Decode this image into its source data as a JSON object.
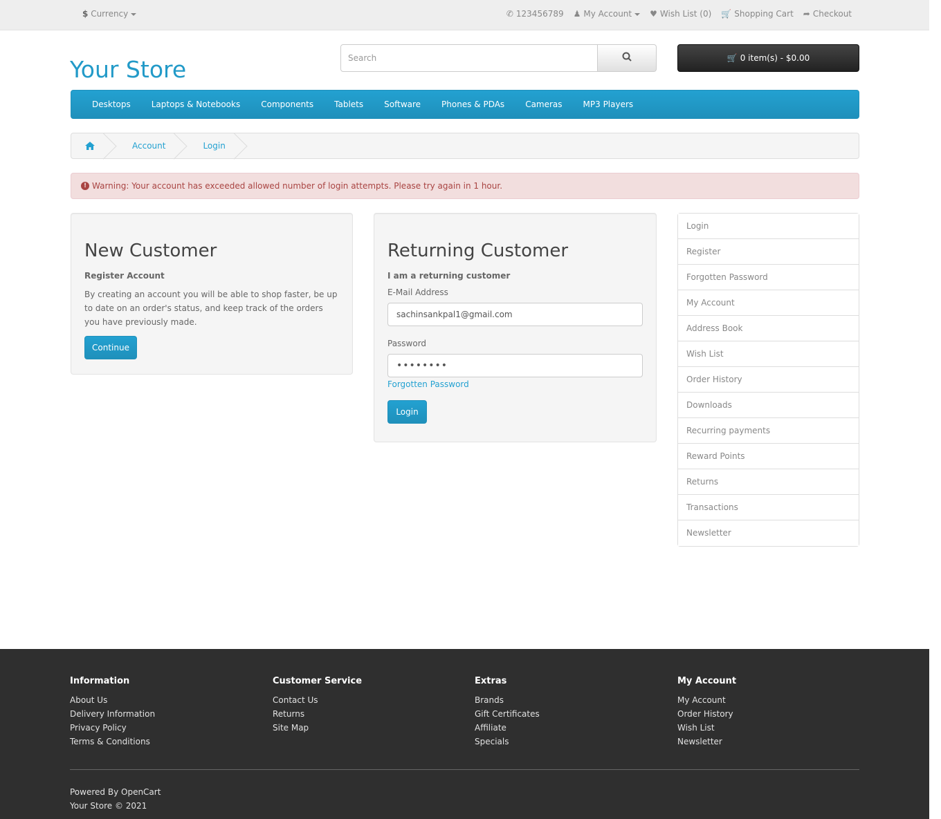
{
  "topbar": {
    "currency_symbol": "$",
    "currency_label": "Currency",
    "phone": "123456789",
    "my_account": "My Account",
    "wish_list": "Wish List (0)",
    "shopping_cart": "Shopping Cart",
    "checkout": "Checkout"
  },
  "header": {
    "logo": "Your Store",
    "search_placeholder": "Search",
    "cart_label": "0 item(s) - $0.00"
  },
  "menu": [
    "Desktops",
    "Laptops & Notebooks",
    "Components",
    "Tablets",
    "Software",
    "Phones & PDAs",
    "Cameras",
    "MP3 Players"
  ],
  "breadcrumb": [
    "Account",
    "Login"
  ],
  "alert": "Warning: Your account has exceeded allowed number of login attempts. Please try again in 1 hour.",
  "new_customer": {
    "title": "New Customer",
    "subtitle": "Register Account",
    "text": "By creating an account you will be able to shop faster, be up to date on an order's status, and keep track of the orders you have previously made.",
    "button": "Continue"
  },
  "returning_customer": {
    "title": "Returning Customer",
    "subtitle": "I am a returning customer",
    "email_label": "E-Mail Address",
    "email_value": "sachinsankpal1@gmail.com",
    "password_label": "Password",
    "password_value": "••••••••",
    "forgotten": "Forgotten Password",
    "button": "Login"
  },
  "sidebar": [
    "Login",
    "Register",
    "Forgotten Password",
    "My Account",
    "Address Book",
    "Wish List",
    "Order History",
    "Downloads",
    "Recurring payments",
    "Reward Points",
    "Returns",
    "Transactions",
    "Newsletter"
  ],
  "footer": {
    "information": {
      "title": "Information",
      "links": [
        "About Us",
        "Delivery Information",
        "Privacy Policy",
        "Terms & Conditions"
      ]
    },
    "customer_service": {
      "title": "Customer Service",
      "links": [
        "Contact Us",
        "Returns",
        "Site Map"
      ]
    },
    "extras": {
      "title": "Extras",
      "links": [
        "Brands",
        "Gift Certificates",
        "Affiliate",
        "Specials"
      ]
    },
    "my_account": {
      "title": "My Account",
      "links": [
        "My Account",
        "Order History",
        "Wish List",
        "Newsletter"
      ]
    },
    "powered_prefix": "Powered By",
    "powered_link": "OpenCart",
    "copyright": "Your Store © 2021"
  }
}
